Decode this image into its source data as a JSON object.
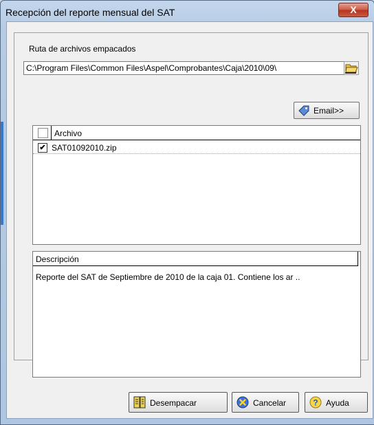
{
  "window": {
    "title": "Recepción del reporte mensual del SAT",
    "close_label": "X"
  },
  "path": {
    "label": "Ruta de archivos empacados",
    "value": "C:\\Program Files\\Common Files\\Aspel\\Comprobantes\\Caja\\2010\\09\\"
  },
  "email_button": {
    "label": "Email>>"
  },
  "file_list": {
    "header": "Archivo",
    "rows": [
      {
        "checked": true,
        "name": "SAT01092010.zip"
      }
    ]
  },
  "description": {
    "header": "Descripción",
    "text": "Reporte del SAT de Septiembre de 2010 de la caja 01. Contiene los ar .."
  },
  "buttons": {
    "unpack": "Desempacar",
    "cancel": "Cancelar",
    "help": "Ayuda"
  },
  "colors": {
    "titlebar": "#b9cde6",
    "close": "#c4483a",
    "accent": "#2d63b8"
  },
  "icons": {
    "folder": "folder-open-icon",
    "email": "email-tag-icon",
    "unpack": "unpack-icon",
    "cancel": "cancel-icon",
    "help": "help-icon"
  }
}
